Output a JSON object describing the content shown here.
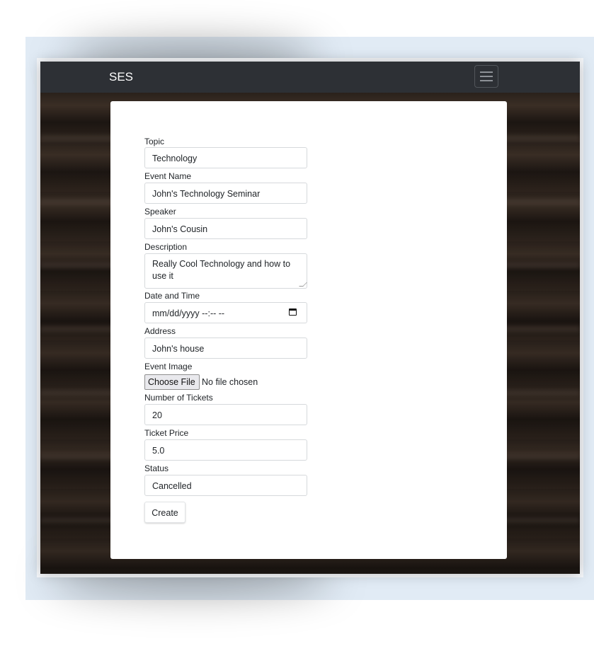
{
  "navbar": {
    "brand": "SES",
    "menu_icon": "hamburger-menu-icon"
  },
  "form": {
    "topic": {
      "label": "Topic",
      "value": "Technology"
    },
    "event_name": {
      "label": "Event Name",
      "value": "John's Technology Seminar"
    },
    "speaker": {
      "label": "Speaker",
      "value": "John's Cousin"
    },
    "description": {
      "label": "Description",
      "value": "Really Cool Technology and how to use it"
    },
    "datetime": {
      "label": "Date and Time",
      "placeholder": "mm/dd/yyyy --:-- --",
      "icon": "calendar-icon"
    },
    "address": {
      "label": "Address",
      "value": "John's house"
    },
    "image": {
      "label": "Event Image",
      "button": "Choose File",
      "status": "No file chosen"
    },
    "tickets": {
      "label": "Number of Tickets",
      "value": "20"
    },
    "price": {
      "label": "Ticket Price",
      "value": "5.0"
    },
    "status": {
      "label": "Status",
      "value": "Cancelled"
    },
    "submit_label": "Create"
  },
  "colors": {
    "navbar_bg": "#2d3035",
    "frame_bg": "#e1ebf5",
    "card_bg": "#ffffff",
    "text": "#212529"
  }
}
